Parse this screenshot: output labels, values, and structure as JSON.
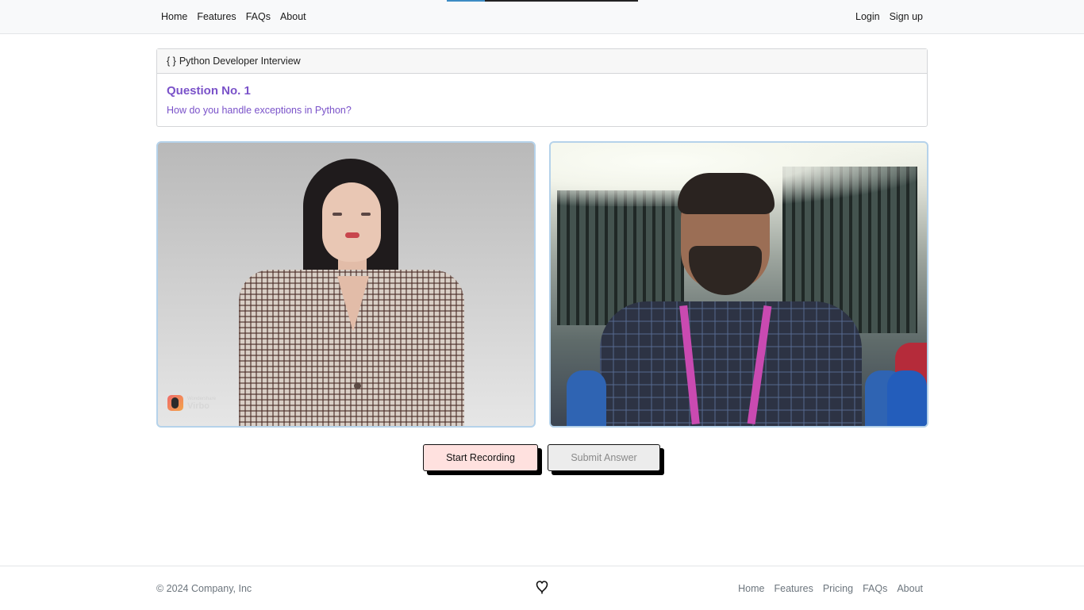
{
  "nav": {
    "left": [
      "Home",
      "Features",
      "FAQs",
      "About"
    ],
    "right": [
      "Login",
      "Sign up"
    ],
    "progress_fraction": 0.2
  },
  "interview": {
    "header_icon": "{ }",
    "header_title": "Python Developer Interview",
    "question_title": "Question No. 1",
    "question_text": "How do you handle exceptions in Python?"
  },
  "avatar": {
    "watermark_small": "Wondershare",
    "watermark_big": "Virbo"
  },
  "buttons": {
    "start_recording": "Start Recording",
    "submit_answer": "Submit Answer"
  },
  "footer": {
    "copyright": "© 2024 Company, Inc",
    "icon": "heart-icon",
    "links": [
      "Home",
      "Features",
      "Pricing",
      "FAQs",
      "About"
    ]
  },
  "colors": {
    "accent_purple": "#7a52c9",
    "record_button_bg": "#ffe1df",
    "video_border": "#b5d2ea"
  }
}
